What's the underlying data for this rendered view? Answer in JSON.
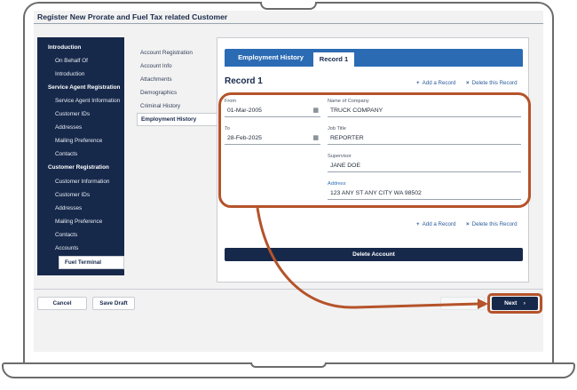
{
  "app_title": "Register New Prorate and Fuel Tax related Customer",
  "sidebar": {
    "items": [
      {
        "label": "Introduction",
        "kind": "section"
      },
      {
        "label": "On Behalf Of",
        "kind": "sub"
      },
      {
        "label": "Introduction",
        "kind": "sub"
      },
      {
        "label": "Service Agent Registration",
        "kind": "section"
      },
      {
        "label": "Service Agent Information",
        "kind": "sub"
      },
      {
        "label": "Customer IDs",
        "kind": "sub"
      },
      {
        "label": "Addresses",
        "kind": "sub"
      },
      {
        "label": "Mailing Preference",
        "kind": "sub"
      },
      {
        "label": "Contacts",
        "kind": "sub"
      },
      {
        "label": "Customer Registration",
        "kind": "section"
      },
      {
        "label": "Customer Information",
        "kind": "sub"
      },
      {
        "label": "Customer IDs",
        "kind": "sub"
      },
      {
        "label": "Addresses",
        "kind": "sub"
      },
      {
        "label": "Mailing Preference",
        "kind": "sub"
      },
      {
        "label": "Contacts",
        "kind": "sub"
      },
      {
        "label": "Accounts",
        "kind": "sub"
      },
      {
        "label": "Fuel Terminal",
        "kind": "active"
      }
    ]
  },
  "midnav": {
    "items": [
      {
        "label": "Account Registration"
      },
      {
        "label": "Account Info"
      },
      {
        "label": "Attachments"
      },
      {
        "label": "Demographics"
      },
      {
        "label": "Criminal History"
      },
      {
        "label": "Employment History",
        "active": true
      }
    ]
  },
  "tabs": [
    {
      "label": "Employment History"
    },
    {
      "label": "Record 1",
      "active": true
    }
  ],
  "record": {
    "title": "Record 1",
    "add_label": "Add a Record",
    "delete_label": "Delete this Record",
    "from_label": "From",
    "from_value": "01-Mar-2005",
    "to_label": "To",
    "to_value": "28-Feb-2025",
    "company_label": "Name of Company",
    "company_value": "TRUCK COMPANY",
    "job_label": "Job Title",
    "job_value": "REPORTER",
    "supervisor_label": "Supervisor",
    "supervisor_value": "JANE DOE",
    "address_label": "Address",
    "address_value": "123 ANY ST ANY CITY WA 98502",
    "delete_account_label": "Delete Account"
  },
  "footer": {
    "cancel_label": "Cancel",
    "save_draft_label": "Save Draft",
    "next_label": "Next",
    "next_chevron": "›"
  },
  "icons": {
    "plus": "+",
    "close": "×",
    "calendar": "▦"
  },
  "colors": {
    "navy": "#17294b",
    "tab_blue": "#2b6bb4",
    "highlight": "#b5532a"
  }
}
